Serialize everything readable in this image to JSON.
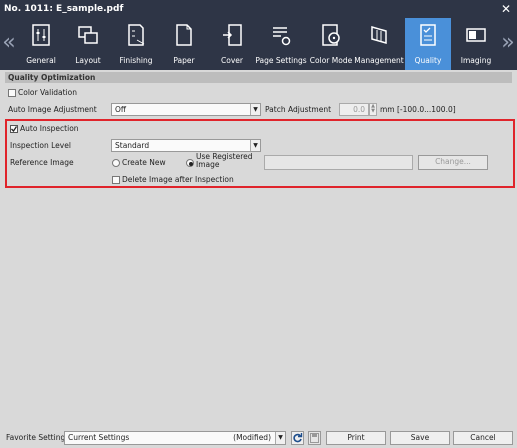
{
  "window": {
    "title": "No. 1011: E_sample.pdf",
    "close_glyph": "✕"
  },
  "toolbar": {
    "prev_arrow": "«",
    "next_arrow": "»",
    "items": [
      {
        "label": "General",
        "icon": "general-icon"
      },
      {
        "label": "Layout",
        "icon": "layout-icon"
      },
      {
        "label": "Finishing",
        "icon": "finishing-icon"
      },
      {
        "label": "Paper",
        "icon": "paper-icon"
      },
      {
        "label": "Cover",
        "icon": "cover-icon"
      },
      {
        "label": "Page Settings",
        "icon": "page-settings-icon"
      },
      {
        "label": "Color Mode",
        "icon": "color-mode-icon"
      },
      {
        "label": "Management",
        "icon": "management-icon"
      },
      {
        "label": "Quality",
        "icon": "quality-icon",
        "active": true
      },
      {
        "label": "Imaging",
        "icon": "imaging-icon"
      }
    ],
    "active_color": "#4a90d9",
    "bg_color": "#2e3546"
  },
  "section": {
    "title": "Quality Optimization"
  },
  "color_validation": {
    "label": "Color Validation",
    "checked": false
  },
  "auto_image_adjustment": {
    "label": "Auto Image Adjustment",
    "value": "Off"
  },
  "patch_adjustment": {
    "label": "Patch Adjustment",
    "value": "0.0",
    "unit": "mm [-100.0...100.0]"
  },
  "auto_inspection": {
    "label": "Auto Inspection",
    "checked": true
  },
  "inspection_level": {
    "label": "Inspection Level",
    "value": "Standard"
  },
  "reference_image": {
    "label": "Reference Image",
    "create_new": "Create New",
    "use_registered_line1": "Use Registered",
    "use_registered_line2": "Image",
    "selected": "use_registered",
    "path_value": "",
    "change_button": "Change..."
  },
  "delete_after_inspection": {
    "label": "Delete Image after Inspection",
    "checked": false
  },
  "highlight_color": "#e0242b",
  "footer": {
    "favorite_label": "Favorite Setting",
    "favorite_value": "Current Settings",
    "favorite_status": "(Modified)",
    "print": "Print",
    "save": "Save",
    "cancel": "Cancel"
  }
}
